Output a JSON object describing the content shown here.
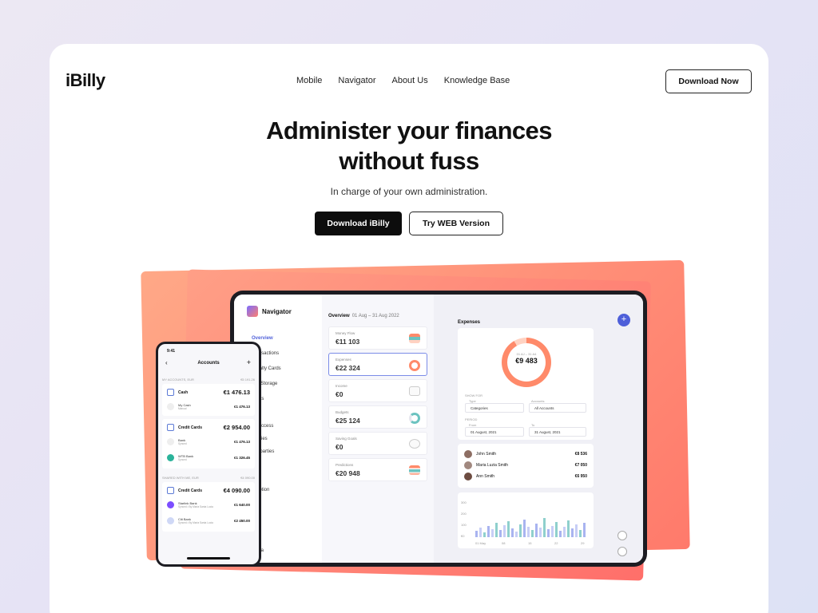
{
  "brand": "iBilly",
  "nav": [
    "Mobile",
    "Navigator",
    "About Us",
    "Knowledge Base"
  ],
  "header_cta": "Download Now",
  "hero": {
    "title_line1": "Administer your finances",
    "title_line2": "without fuss",
    "subtitle": "In charge of your own administration.",
    "primary_cta": "Download iBilly",
    "secondary_cta": "Try WEB Version"
  },
  "tablet": {
    "app_name": "Navigator",
    "sidebar": [
      "Overview",
      "Transactions",
      "Loyalty Cards",
      "File Storage",
      "Alerts",
      "ndary",
      "ed Access",
      "egories",
      "nterparties",
      "nies",
      "s",
      "scription"
    ],
    "sidebar_user": "Maria",
    "overview": {
      "title": "Overview",
      "range": "01 Aug – 31 Aug 2022",
      "cards": [
        {
          "label": "Money Flow",
          "value": "€11 103"
        },
        {
          "label": "Expenses",
          "value": "€22 324"
        },
        {
          "label": "Income",
          "value": "€0"
        },
        {
          "label": "Budgets",
          "value": "€25 124"
        },
        {
          "label": "Saving Goals",
          "value": "€0"
        },
        {
          "label": "Predictions",
          "value": "€20 948"
        }
      ]
    },
    "expenses": {
      "title": "Expenses",
      "donut_range": "01 AJ – 31 A4",
      "donut_value": "€9 483",
      "show_for": "SHOW FOR",
      "type_label": "Type",
      "type_value": "Categories",
      "accounts_label": "Accounts",
      "accounts_value": "All Accounts",
      "period": "PERIOD",
      "from_label": "From",
      "from_value": "01 August, 2021",
      "to_label": "To",
      "to_value": "31 August, 2021",
      "people": [
        {
          "name": "John Smith",
          "amount": "€8 536"
        },
        {
          "name": "Maria Luzia Smith",
          "amount": "€7 050"
        },
        {
          "name": "Ann Smith",
          "amount": "€6 950"
        }
      ],
      "chart_ticks": [
        "01 May",
        "08",
        "15",
        "22",
        "29"
      ],
      "chart_y": [
        "300",
        "200",
        "100",
        "€0"
      ]
    }
  },
  "phone": {
    "time": "9:41",
    "title": "Accounts",
    "my_accounts": "MY ACCOUNTS, EUR",
    "my_accounts_total": "€5 191.26",
    "cash_label": "Cash",
    "cash_value": "€1 476.13",
    "my_cash": "My Cash",
    "my_cash_meta": "Manual",
    "my_cash_value": "€1 476.13",
    "credit_label": "Credit Cards",
    "credit_value": "€2 954.00",
    "bank1": "Bank",
    "bank1_meta": "Synced",
    "bank1_value": "€1 476.13",
    "bank2": "WTB Bank",
    "bank2_meta": "Synced",
    "bank2_value": "€1 326.45",
    "shared": "SHARED WITH ME, EUR",
    "shared_total": "€4 090.00",
    "shared_credit": "Credit Cards",
    "shared_credit_value": "€4 090.00",
    "bank3": "Starlink Bank",
    "bank3_meta": "Synced • By Maria Santa Lucia",
    "bank3_value": "€1 640.00",
    "bank4": "Citi Bank",
    "bank4_meta": "Synced • By Maria Santa Lucia",
    "bank4_value": "€2 450.00"
  }
}
